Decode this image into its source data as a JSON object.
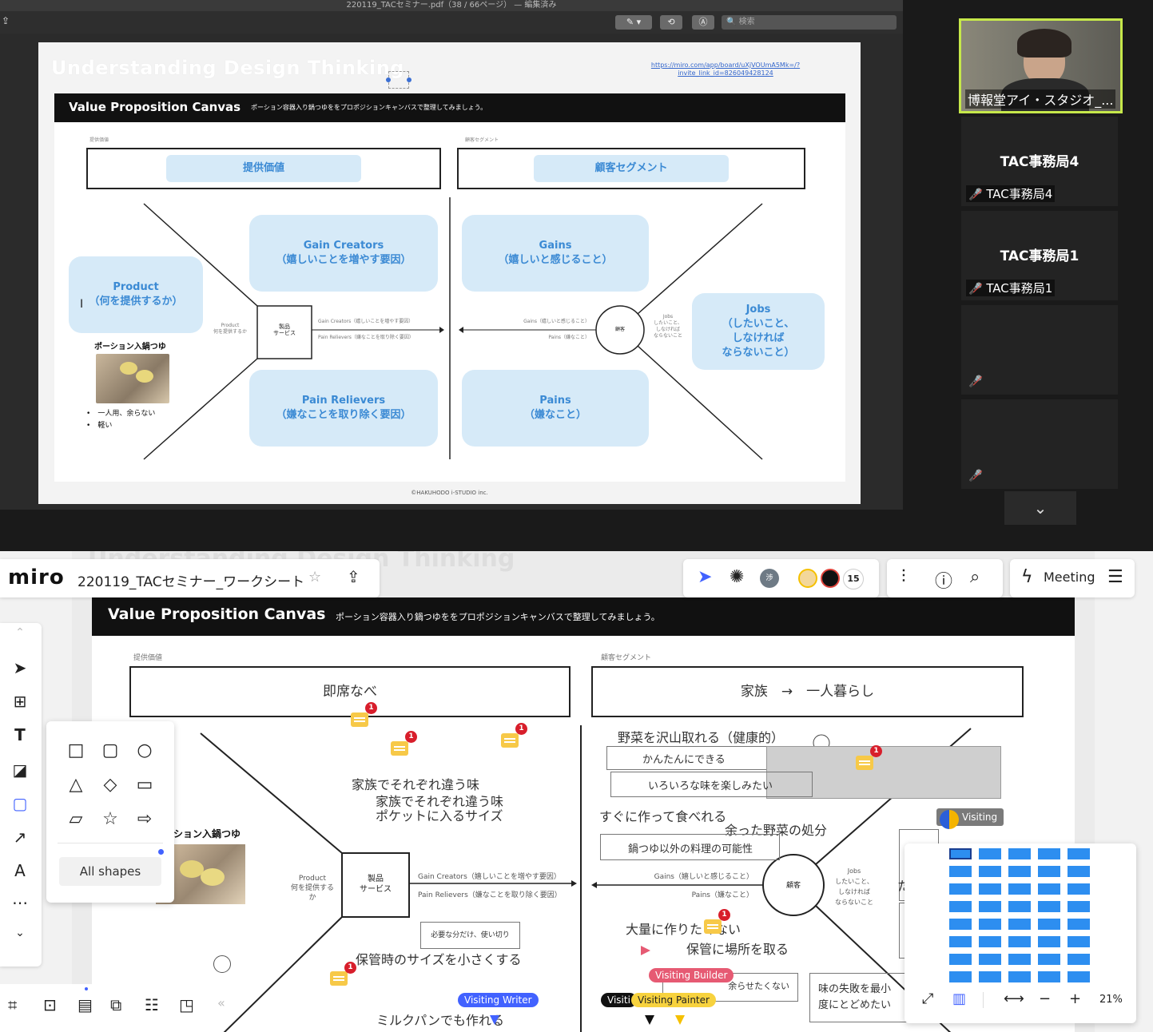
{
  "zoom": {
    "pdf_title": "220119_TACセミナー.pdf（38 / 66ページ） — 編集済み",
    "search_placeholder": "検索",
    "slide": {
      "title": "Understanding Design Thinking",
      "link_line1": "https://miro.com/app/board/uXjVOUmA5Mk=/?",
      "link_line2": "invite_link_id=826049428124",
      "header_title": "Value Proposition Canvas",
      "header_sub": "ポーション容器入り鍋つゆををプロポジションキャンバスで整理してみましょう。",
      "label_left": "提供価値",
      "label_right": "顧客セグメント",
      "pill_left": "提供価値",
      "pill_right": "顧客セグメント",
      "gain_creators_1": "Gain Creators",
      "gain_creators_2": "（嬉しいことを増やす要因）",
      "gains_1": "Gains",
      "gains_2": "（嬉しいと感じること）",
      "product_1": "Product",
      "product_2": "（何を提供するか）",
      "pain_relievers_1": "Pain Relievers",
      "pain_relievers_2": "（嫌なことを取り除く要因）",
      "pains_1": "Pains",
      "pains_2": "（嫌なこと）",
      "jobs_1": "Jobs",
      "jobs_2": "（したいこと、",
      "jobs_3": "しなければ",
      "jobs_4": "ならないこと）",
      "product_small_1": "Product",
      "product_small_2": "何を提供するか",
      "service_1": "製品",
      "service_2": "サービス",
      "customer": "顧客",
      "arrow_gc": "Gain Creators（嬉しいことを増やす要因）",
      "arrow_pr": "Pain Relievers（嫌なことを取り除く要因）",
      "arrow_gains": "Gains（嬉しいと感じること）",
      "arrow_pains": "Pains（嫌なこと）",
      "jobs_small_1": "Jobs",
      "jobs_small_2": "したいこと、",
      "jobs_small_3": "しなければ",
      "jobs_small_4": "ならないこと",
      "example_title": "ポーション入鍋つゆ",
      "bullet_1": "一人用、余らない",
      "bullet_2": "軽い",
      "footer": "©HAKUHODO i-STUDIO inc."
    },
    "participants": {
      "video_name": "博報堂アイ・スタジオ_...",
      "p1_big": "TAC事務局4",
      "p1_small": "TAC事務局4",
      "p2_big": "TAC事務局1",
      "p2_small": "TAC事務局1"
    }
  },
  "miro": {
    "logo": "miro",
    "board_name": "220119_TACセミナー_ワークシート",
    "collab_count": "15",
    "meeting_label": "Meeting",
    "ghost_title": "Understanding Design Thinking",
    "board": {
      "header_title": "Value Proposition Canvas",
      "header_sub": "ポーション容器入り鍋つゆををプロポジションキャンバスで整理してみましょう。",
      "label_left": "提供価値",
      "label_right": "顧客セグメント",
      "box_left": "即席なべ",
      "box_right": "家族　→　一人暮らし",
      "note_1": "家族でそれぞれ違う味",
      "note_2": "家族でそれぞれ違う味",
      "note_3": "ポケットに入るサイズ",
      "note_4": "野菜を沢山取れる（健康的）",
      "note_5": "かんたんにできる",
      "note_6": "いろいろな味を楽しみたい",
      "note_7": "すぐに作って食べれる",
      "note_8": "余った野菜の処分",
      "note_9": "鍋つゆ以外の料理の可能性",
      "note_10": "大量に作りたくない",
      "note_11": "保管に場所を取る",
      "note_12": "保管時のサイズを小さくする",
      "note_13": "必要な分だけ、使い切り",
      "note_14": "ミルクパンでも作れる",
      "note_15": "余らせたくない",
      "note_16": "味の失敗を最小",
      "note_17": "度にとどめたい",
      "example_title": "ション入鍋つゆ",
      "product_1": "Product",
      "product_2": "何を提供するか",
      "service_1": "製品",
      "service_2": "サービス",
      "customer": "顧客",
      "arrow_gc": "Gain Creators（嬉しいことを増やす要因）",
      "arrow_pr": "Pain Relievers（嫌なことを取り除く要因）",
      "arrow_gains": "Gains（嬉しいと感じること）",
      "arrow_pains": "Pains（嫌なこと）",
      "jobs_1": "Jobs",
      "jobs_2": "したいこと、",
      "jobs_3": "しなければ",
      "jobs_4": "ならないこと",
      "cut_char": "た"
    },
    "badges": [
      "1",
      "1",
      "1",
      "1",
      "1",
      "1"
    ],
    "visiting": {
      "v1": "Visiting",
      "v2": "Visiting Builder",
      "v3": "Visiting Writer",
      "v4": "Visiti",
      "v5": "Visiting Painter"
    },
    "shapes_panel": {
      "all_shapes": "All shapes"
    },
    "zoom_level": "21%",
    "colors": {
      "accent": "#4262ff",
      "minimap": "#2d8ef0",
      "comment": "#f7c948",
      "badge": "#d81e2b"
    }
  }
}
